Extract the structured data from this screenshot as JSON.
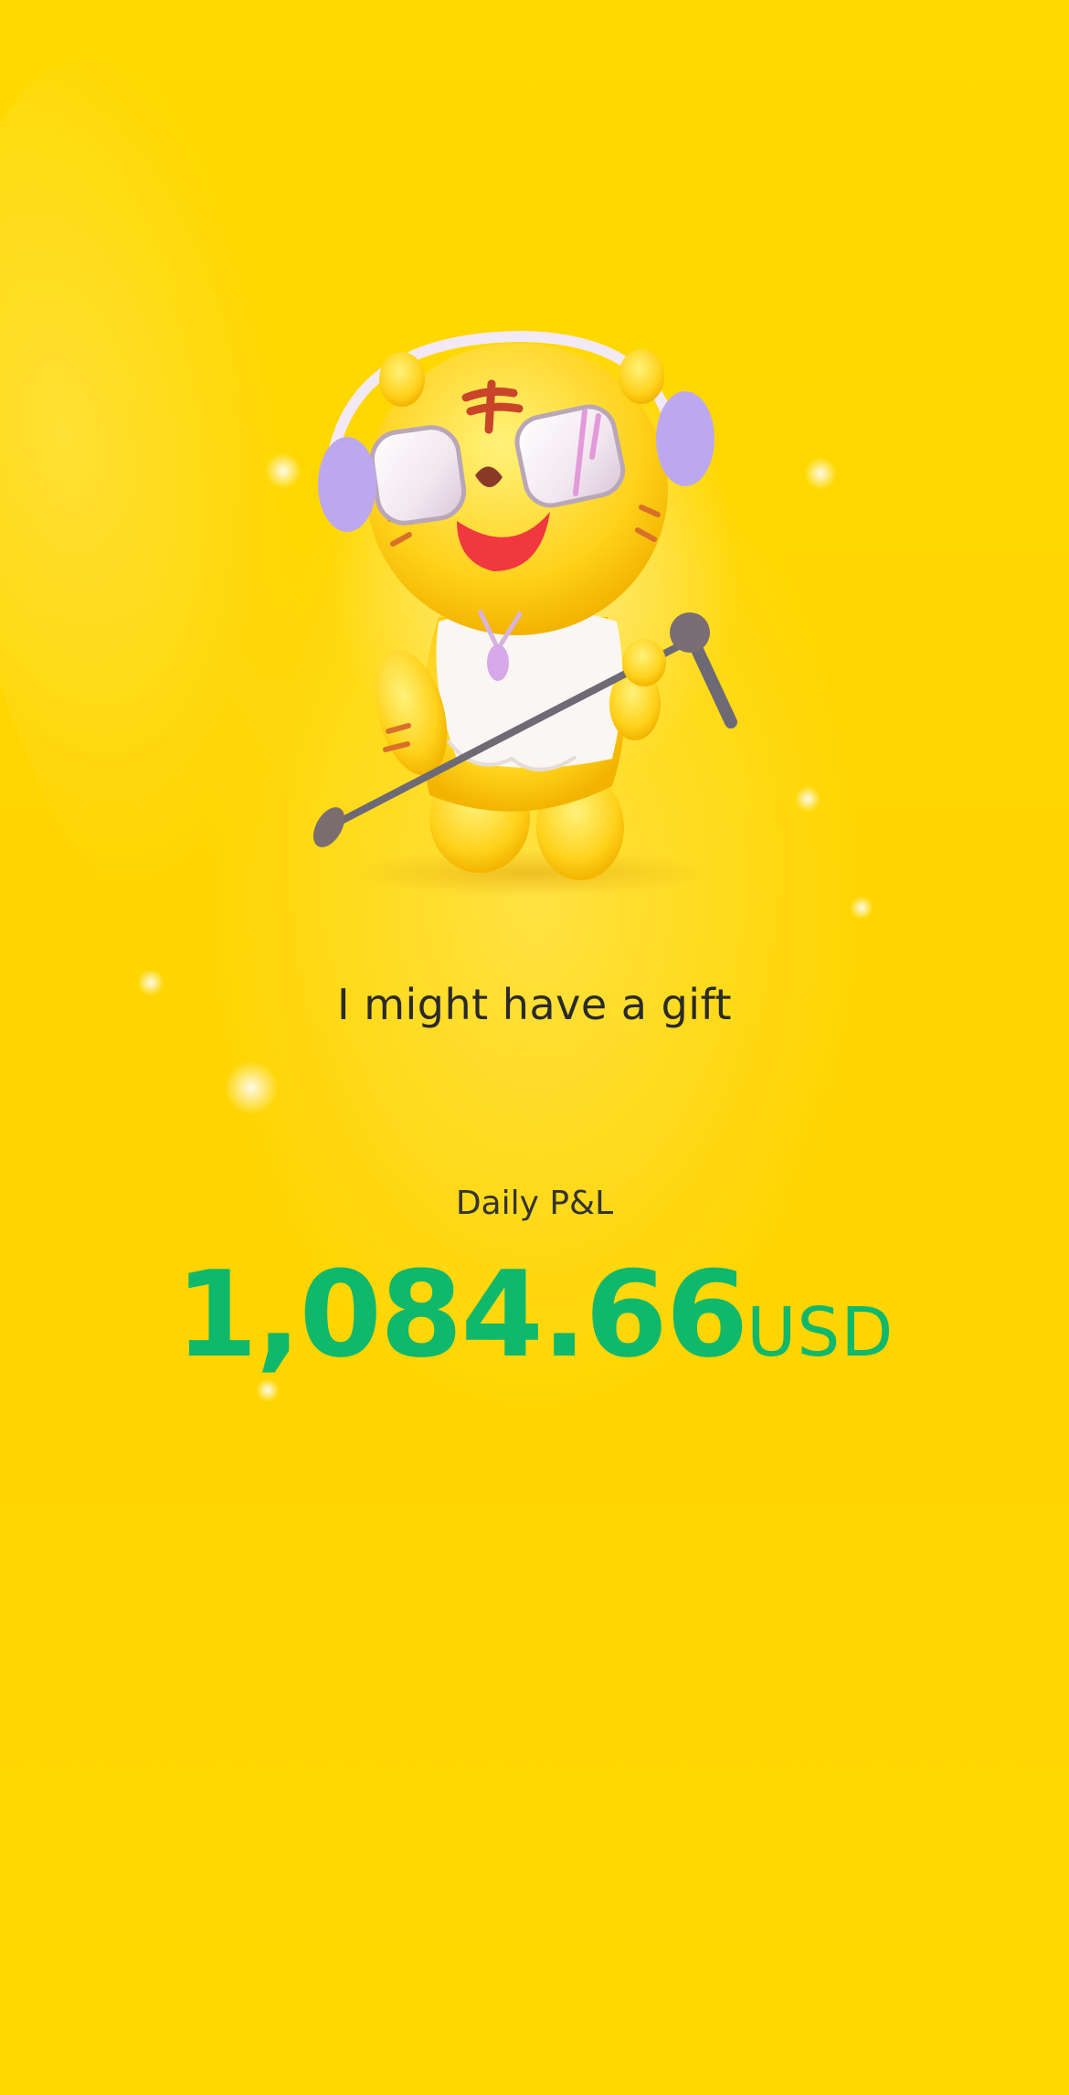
{
  "headline": "I might have a gift",
  "pnl": {
    "label": "Daily P&L",
    "value": "1,084.66",
    "currency": "USD"
  },
  "colors": {
    "background": "#FFD400",
    "profit_green": "#0FB86B",
    "text_dark": "#2A2A2A"
  },
  "icons": {
    "mascot": "tiger-mascot-with-headphones-and-microphone"
  }
}
